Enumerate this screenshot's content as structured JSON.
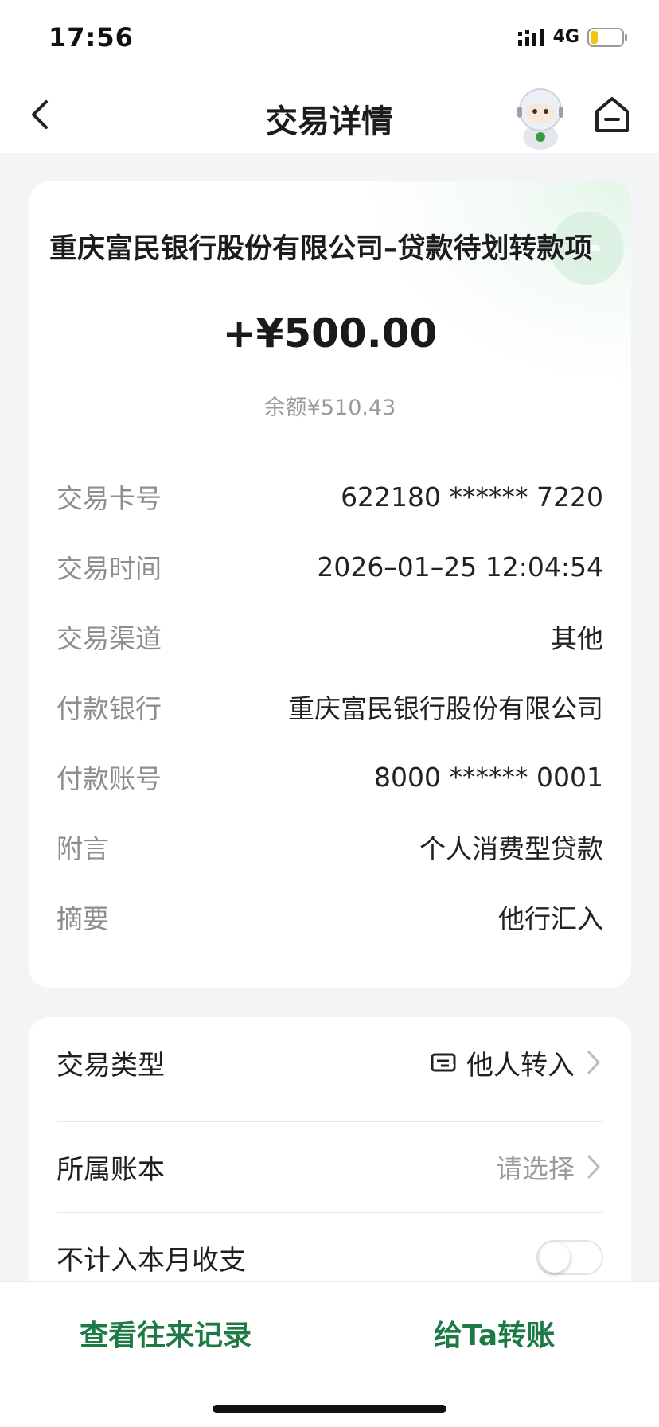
{
  "status_bar": {
    "time": "17:56",
    "network": "4G"
  },
  "nav": {
    "title": "交易详情",
    "back_icon": "chevron-left-icon",
    "assistant_icon": "robot-assistant-icon",
    "home_icon": "home-icon"
  },
  "transaction": {
    "payee": "重庆富民银行股份有限公司–贷款待划转款项",
    "amount": "+¥500.00",
    "balance": "余额¥510.43",
    "details": [
      {
        "label": "交易卡号",
        "value": "622180 ****** 7220"
      },
      {
        "label": "交易时间",
        "value": "2026–01–25 12:04:54"
      },
      {
        "label": "交易渠道",
        "value": "其他"
      },
      {
        "label": "付款银行",
        "value": "重庆富民银行股份有限公司"
      },
      {
        "label": "付款账号",
        "value": "8000 ****** 0001"
      },
      {
        "label": "附言",
        "value": "个人消费型贷款"
      },
      {
        "label": "摘要",
        "value": "他行汇入"
      }
    ]
  },
  "settings": {
    "type_label": "交易类型",
    "type_value": "他人转入",
    "ledger_label": "所属账本",
    "ledger_placeholder": "请选择",
    "exclude_label": "不计入本月收支",
    "exclude_on": false
  },
  "actions": {
    "history": "查看往来记录",
    "transfer": "给Ta转账"
  },
  "colors": {
    "accent": "#1e7a45",
    "page_bg": "#f3f4f6"
  }
}
